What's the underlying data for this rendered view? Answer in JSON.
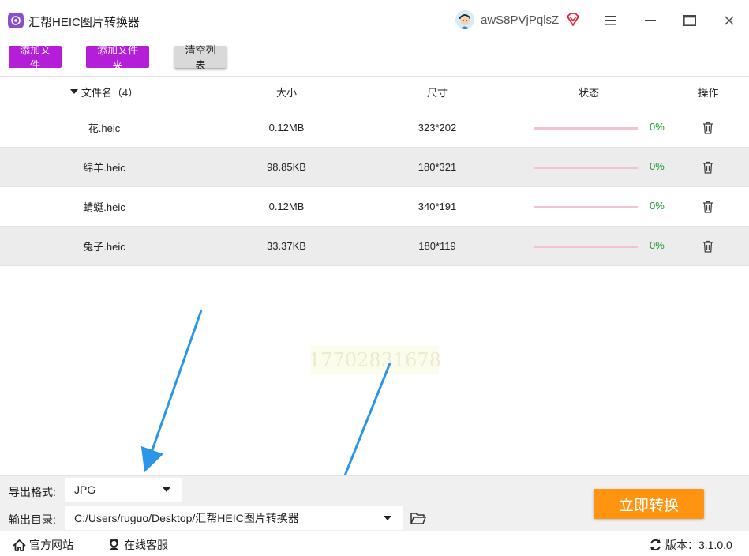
{
  "app": {
    "title": "汇帮HEIC图片转换器",
    "username": "awS8PVjPqlsZ",
    "icons": {
      "logo": "app-logo-icon",
      "avatar": "user-avatar",
      "vip": "vip-diamond-icon",
      "menu": "menu-icon",
      "minimize": "minimize-icon",
      "maximize": "maximize-icon",
      "close": "close-icon"
    }
  },
  "toolbar": {
    "add_file": "添加文件",
    "add_folder": "添加文件夹",
    "clear_list": "清空列表"
  },
  "table": {
    "headers": {
      "name": "文件名（4）",
      "size": "大小",
      "dimensions": "尺寸",
      "status": "状态",
      "action": "操作"
    },
    "rows": [
      {
        "name": "花.heic",
        "size": "0.12MB",
        "dimensions": "323*202",
        "progress": 0,
        "percent": "0%"
      },
      {
        "name": "绵羊.heic",
        "size": "98.85KB",
        "dimensions": "180*321",
        "progress": 0,
        "percent": "0%"
      },
      {
        "name": "蜻蜓.heic",
        "size": "0.12MB",
        "dimensions": "340*191",
        "progress": 0,
        "percent": "0%"
      },
      {
        "name": "兔子.heic",
        "size": "33.37KB",
        "dimensions": "180*119",
        "progress": 0,
        "percent": "0%"
      }
    ]
  },
  "watermark": "17702831678",
  "settings": {
    "format_label": "导出格式:",
    "format_value": "JPG",
    "output_label": "输出目录:",
    "output_path": "C:/Users/ruguo/Desktop/汇帮HEIC图片转换器",
    "convert_button": "立即转换"
  },
  "footer": {
    "website": "官方网站",
    "support": "在线客服",
    "version": "版本：3.1.0.0"
  },
  "colors": {
    "accent_purple": "#b51ed9",
    "convert_orange": "#ff9410",
    "percent_green": "#1a9a2a",
    "progress_track": "#f2c2cf",
    "annotation_arrow": "#2a96e8"
  }
}
